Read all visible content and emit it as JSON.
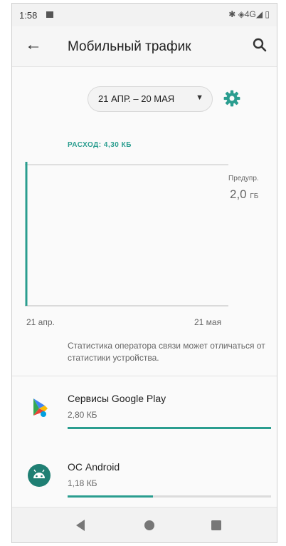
{
  "status_bar": {
    "time": "1:58",
    "indicators": "✱ ◈4G◢ ▯"
  },
  "app_bar": {
    "title": "Мобильный трафик",
    "back_icon": "arrow-back-icon",
    "search_icon": "search-icon"
  },
  "date_selector": {
    "value": "21 АПР. – 20 МАЯ"
  },
  "usage": {
    "label": "РАСХОД: 4,30 КБ"
  },
  "chart_data": {
    "type": "line",
    "x_labels": [
      "21 апр.",
      "21 мая"
    ],
    "limit_label": "Предупр.",
    "limit_value": "2,0",
    "limit_unit": "ГБ",
    "usage_color": "#2a9d8f"
  },
  "note": "Статистика оператора связи может отличаться от статистики устройства.",
  "apps": [
    {
      "name": "Сервисы Google Play",
      "size": "2,80 КБ",
      "fraction": 1.0,
      "icon": "google-play-services-icon"
    },
    {
      "name": "ОС Android",
      "size": "1,18 КБ",
      "fraction": 0.42,
      "icon": "android-os-icon"
    }
  ],
  "colors": {
    "accent": "#2a9d8f"
  }
}
